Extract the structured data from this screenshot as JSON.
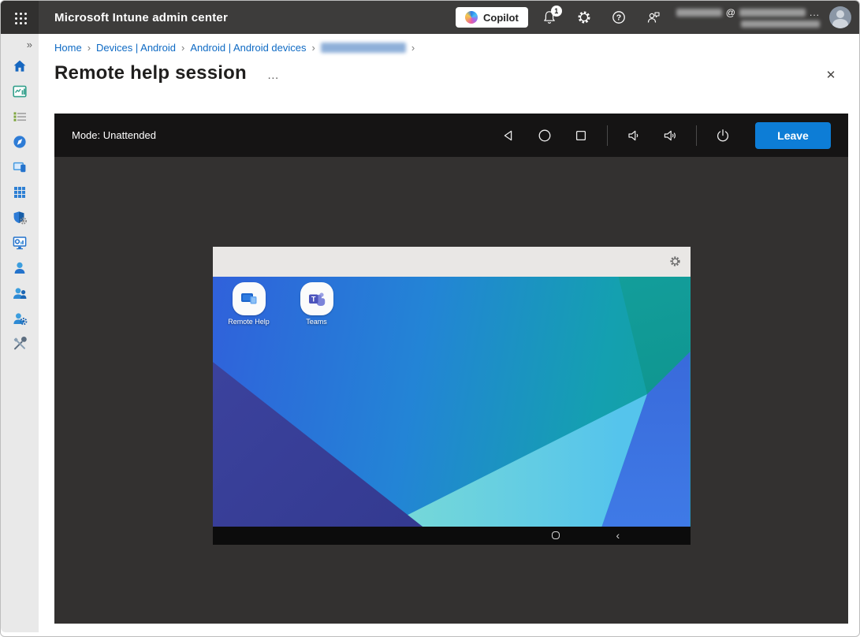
{
  "window": {
    "title": "Microsoft Intune admin center"
  },
  "topbar": {
    "copilot_label": "Copilot",
    "notification_count": "1",
    "help_glyph": "?",
    "account": {
      "at_symbol": "@",
      "overflow": "...",
      "email_redacted": true,
      "tenant_redacted": true
    }
  },
  "sidebar": {
    "expand_glyph": "»",
    "items": [
      {
        "icon": "home-icon"
      },
      {
        "icon": "dashboard-icon"
      },
      {
        "icon": "all-services-icon"
      },
      {
        "icon": "compass-icon"
      },
      {
        "icon": "devices-icon"
      },
      {
        "icon": "apps-icon"
      },
      {
        "icon": "endpoint-security-icon"
      },
      {
        "icon": "reports-icon"
      },
      {
        "icon": "users-icon"
      },
      {
        "icon": "groups-icon"
      },
      {
        "icon": "tenant-admin-icon"
      },
      {
        "icon": "troubleshooting-icon"
      }
    ]
  },
  "breadcrumb": {
    "separator": "›",
    "items": [
      {
        "label": "Home",
        "redacted": false
      },
      {
        "label": "Devices | Android",
        "redacted": false
      },
      {
        "label": "Android | Android devices",
        "redacted": false
      },
      {
        "label": "",
        "redacted": true
      }
    ]
  },
  "page": {
    "title": "Remote help session",
    "overflow_glyph": "…",
    "close_glyph": "✕"
  },
  "session": {
    "mode_label": "Mode: Unattended",
    "leave_button": "Leave",
    "colors": {
      "leave_button": "#0d7dd6",
      "toolbar_bg": "#151414",
      "stage_bg": "#333130"
    }
  },
  "device": {
    "apps": [
      {
        "label": "Remote Help"
      },
      {
        "label": "Teams",
        "logo_letter": "T"
      }
    ],
    "nav": {
      "back_glyph": "‹"
    },
    "wallpaper_colors": {
      "base_left": "#3061db",
      "base_right": "#12a39b",
      "navy_triangle": "#343b96",
      "cyan_wedge_left": "#93eac6",
      "cyan_wedge_right": "#55c4ec",
      "right_wedge": "#3b70e0"
    }
  }
}
